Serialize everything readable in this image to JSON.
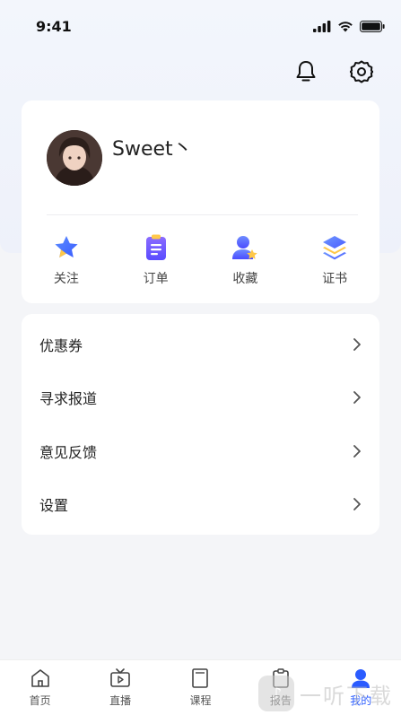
{
  "status_bar": {
    "time": "9:41"
  },
  "header": {
    "bell_icon": "bell-icon",
    "settings_icon": "gear-icon"
  },
  "profile": {
    "username": "Sweet丶"
  },
  "quick_actions": [
    {
      "label": "关注",
      "icon": "star-icon",
      "color": "#3f7bff"
    },
    {
      "label": "订单",
      "icon": "clipboard-icon",
      "color": "#6b56ff"
    },
    {
      "label": "收藏",
      "icon": "user-star-icon",
      "color": "#4c6bff"
    },
    {
      "label": "证书",
      "icon": "layers-icon",
      "color": "#4d7dff"
    }
  ],
  "menu": [
    {
      "label": "优惠券"
    },
    {
      "label": "寻求报道"
    },
    {
      "label": "意见反馈"
    },
    {
      "label": "设置"
    }
  ],
  "tabbar": [
    {
      "label": "首页",
      "icon": "home-icon",
      "active": false
    },
    {
      "label": "直播",
      "icon": "tv-icon",
      "active": false
    },
    {
      "label": "课程",
      "icon": "book-icon",
      "active": false
    },
    {
      "label": "报告",
      "icon": "report-icon",
      "active": false
    },
    {
      "label": "我的",
      "icon": "profile-icon",
      "active": true
    }
  ],
  "watermark": {
    "text": "一听下载"
  },
  "colors": {
    "accent": "#2b5cff",
    "background": "#f4f5f8"
  }
}
